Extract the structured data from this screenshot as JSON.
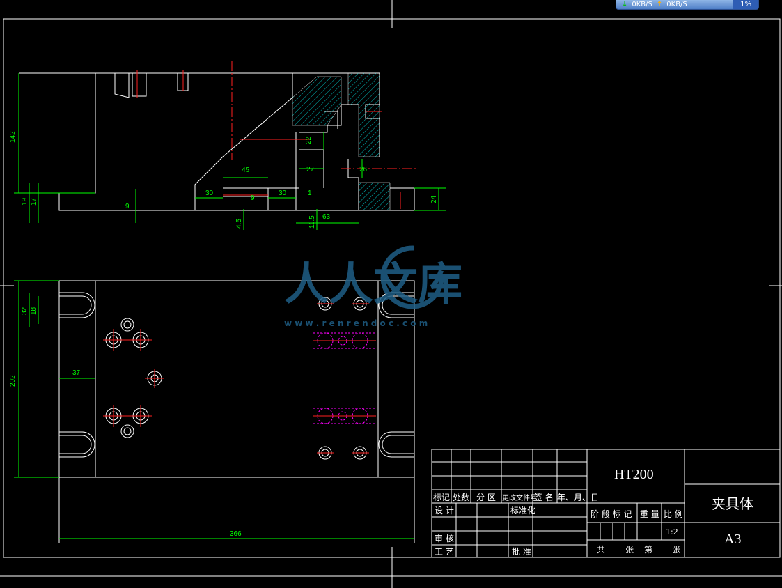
{
  "netbar": {
    "down_rate": "0KB/S",
    "up_rate": "0KB/S",
    "cpu": "1%"
  },
  "watermark": {
    "brand": "人人文库",
    "url": "w w w . r e n r e n d o c . c o m"
  },
  "dimensions": {
    "front": {
      "h142": "142",
      "h19": "19",
      "h17": "17",
      "d9a": "9",
      "d30a": "30",
      "d45": "45",
      "d9b": "9",
      "d30b": "30",
      "d1": "1",
      "d22": "22",
      "d27": "27",
      "d26": "26",
      "d24": "24",
      "d4_5": "4.5",
      "d11_5": "11.5",
      "d63": "63"
    },
    "plan": {
      "d32": "32",
      "d18": "18",
      "d202": "202",
      "d37": "37",
      "d366": "366"
    }
  },
  "title_block": {
    "material": "HT200",
    "part_name": "夹具体",
    "sheet_size": "A3",
    "scale": "1:2",
    "header_row": [
      "标记",
      "处数",
      "分 区",
      "更改文件号",
      "签 名",
      "年、月、日"
    ],
    "design": "设 计",
    "standardize": "标准化",
    "review": "审 核",
    "process": "工 艺",
    "approve": "批 准",
    "stage_mark": "阶 段 标 记",
    "weight": "重 量",
    "ratio": "比 例",
    "total": "共",
    "sheets": "张",
    "no": "第",
    "sheets2": "张"
  }
}
